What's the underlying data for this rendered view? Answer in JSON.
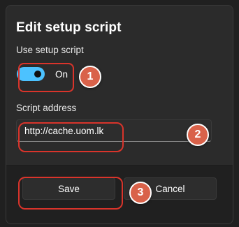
{
  "dialog": {
    "title": "Edit setup script",
    "use_setup_script_label": "Use setup script",
    "toggle": {
      "state_label": "On",
      "is_on": true,
      "accent_color": "#4cc2ff"
    },
    "script_address_label": "Script address",
    "script_address_value": "http://cache.uom.lk",
    "save_label": "Save",
    "cancel_label": "Cancel"
  },
  "annotations": {
    "markers": [
      "1",
      "2",
      "3"
    ],
    "highlight_color": "#d9342b",
    "marker_color": "#d9624a"
  }
}
